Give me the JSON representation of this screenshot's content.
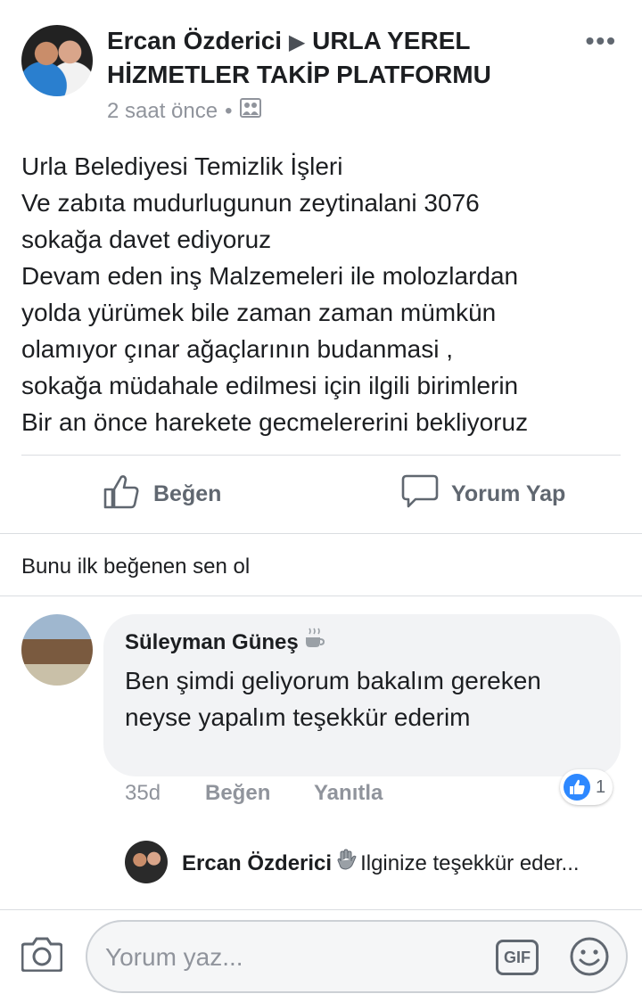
{
  "post": {
    "author": "Ercan Özderici",
    "arrow": "▶",
    "group": "URLA YEREL HİZMETLER TAKİP PLATFORMU",
    "time": "2 saat önce",
    "separator": "•",
    "more": "•••",
    "body": "Urla Belediyesi Temizlik İşleri\nVe zabıta mudurlugunun zeytinalani 3076\nsokağa davet ediyoruz\nDevam eden inş Malzemeleri ile molozlardan\nyolda  yürümek bile zaman zaman mümkün\nolamıyor  çınar ağaçlarının budanmasi ,\n sokağa müdahale edilmesi için ilgili birimlerin\nBir an önce harekete gecmelererini bekliyoruz"
  },
  "actions": {
    "like": "Beğen",
    "comment": "Yorum Yap"
  },
  "first_like": "Bunu ilk beğenen sen ol",
  "comment": {
    "author": "Süleyman Güneş",
    "text": "Ben şimdi geliyorum bakalım gereken neyse yapalım teşekkür ederim",
    "time": "35d",
    "like": "Beğen",
    "reply": "Yanıtla",
    "reaction_count": "1"
  },
  "reply": {
    "author": "Ercan Özderici",
    "text": "Ilginize teşekkür eder..."
  },
  "composer": {
    "placeholder": "Yorum yaz...",
    "gif": "GIF"
  },
  "icons": [
    "ellipsis-icon",
    "photo-icon",
    "thumbs-up-icon",
    "comment-icon",
    "coffee-icon",
    "waving-hand-icon",
    "camera-icon",
    "gif-icon",
    "smiley-icon"
  ],
  "colors": {
    "link_blue": "#2d88ff",
    "muted": "#90949c",
    "bubble": "#f2f3f5"
  }
}
